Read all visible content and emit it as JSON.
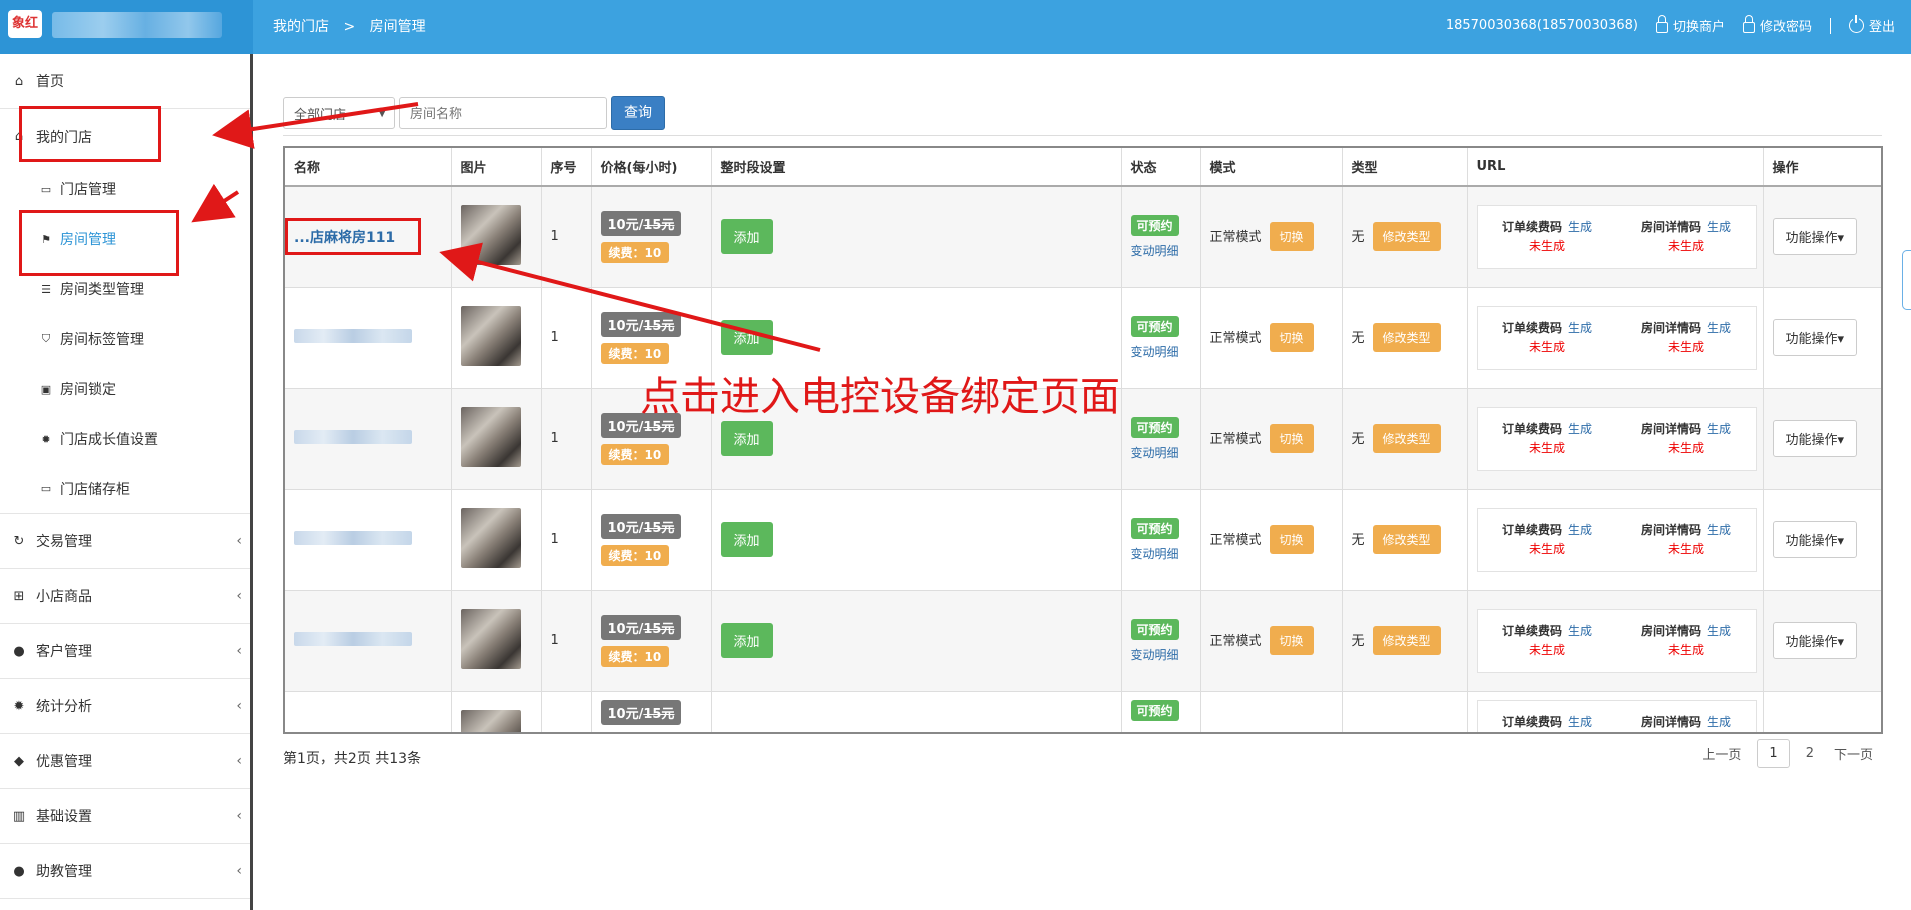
{
  "header": {
    "logo_text": "象红",
    "breadcrumb": [
      "我的门店",
      ">",
      "房间管理"
    ],
    "account": "18570030368(18570030368)",
    "switch_merchant": "切换商户",
    "change_password": "修改密码",
    "logout": "登出"
  },
  "sidebar": {
    "items": [
      {
        "label": "首页",
        "icon": "home-icon"
      },
      {
        "label": "我的门店",
        "icon": "home-icon"
      },
      {
        "label": "交易管理",
        "icon": "refresh-icon"
      },
      {
        "label": "小店商品",
        "icon": "gift-icon"
      },
      {
        "label": "客户管理",
        "icon": "user-icon"
      },
      {
        "label": "统计分析",
        "icon": "gear-icon"
      },
      {
        "label": "优惠管理",
        "icon": "tags-icon"
      },
      {
        "label": "基础设置",
        "icon": "barcode-icon"
      },
      {
        "label": "助教管理",
        "icon": "user-icon"
      }
    ],
    "subitems": [
      {
        "label": "门店管理"
      },
      {
        "label": "房间管理"
      },
      {
        "label": "房间类型管理"
      },
      {
        "label": "房间标签管理"
      },
      {
        "label": "房间锁定"
      },
      {
        "label": "门店成长值设置"
      },
      {
        "label": "门店储存柜"
      }
    ]
  },
  "search": {
    "store_select": "全部门店",
    "room_placeholder": "房间名称",
    "query_button": "查询"
  },
  "table": {
    "headers": [
      "名称",
      "图片",
      "序号",
      "价格(每小时)",
      "整时段设置",
      "状态",
      "模式",
      "类型",
      "URL",
      "操作"
    ],
    "rows": [
      {
        "name": "...店麻将房111",
        "seq": "1",
        "price": "10元/",
        "price_old": "15元",
        "renew": "续费：10",
        "add": "添加",
        "state": "可预约",
        "state_detail": "变动明细",
        "mode": "正常模式",
        "switch": "切换",
        "type": "无",
        "change_type": "修改类型",
        "url_order": "订单续费码",
        "url_room": "房间详情码",
        "gen": "生成",
        "not_gen": "未生成",
        "op": "功能操作▾"
      },
      {
        "name": "",
        "seq": "1",
        "price": "10元/",
        "price_old": "15元",
        "renew": "续费：10",
        "add": "添加",
        "state": "可预约",
        "state_detail": "变动明细",
        "mode": "正常模式",
        "switch": "切换",
        "type": "无",
        "change_type": "修改类型",
        "url_order": "订单续费码",
        "url_room": "房间详情码",
        "gen": "生成",
        "not_gen": "未生成",
        "op": "功能操作▾"
      },
      {
        "name": "",
        "seq": "1",
        "price": "10元/",
        "price_old": "15元",
        "renew": "续费：10",
        "add": "添加",
        "state": "可预约",
        "state_detail": "变动明细",
        "mode": "正常模式",
        "switch": "切换",
        "type": "无",
        "change_type": "修改类型",
        "url_order": "订单续费码",
        "url_room": "房间详情码",
        "gen": "生成",
        "not_gen": "未生成",
        "op": "功能操作▾"
      },
      {
        "name": "",
        "seq": "1",
        "price": "10元/",
        "price_old": "15元",
        "renew": "续费：10",
        "add": "添加",
        "state": "可预约",
        "state_detail": "变动明细",
        "mode": "正常模式",
        "switch": "切换",
        "type": "无",
        "change_type": "修改类型",
        "url_order": "订单续费码",
        "url_room": "房间详情码",
        "gen": "生成",
        "not_gen": "未生成",
        "op": "功能操作▾"
      },
      {
        "name": "",
        "seq": "1",
        "price": "10元/",
        "price_old": "15元",
        "renew": "续费：10",
        "add": "添加",
        "state": "可预约",
        "state_detail": "变动明细",
        "mode": "正常模式",
        "switch": "切换",
        "type": "无",
        "change_type": "修改类型",
        "url_order": "订单续费码",
        "url_room": "房间详情码",
        "gen": "生成",
        "not_gen": "未生成",
        "op": "功能操作▾"
      },
      {
        "name": "",
        "seq": "",
        "price": "10元/",
        "price_old": "15元",
        "renew": "",
        "add": "",
        "state": "可预约",
        "state_detail": "",
        "mode": "",
        "switch": "",
        "type": "",
        "change_type": "",
        "url_order": "订单续费码",
        "url_room": "房间详情码",
        "gen": "生成",
        "not_gen": "",
        "op": ""
      }
    ]
  },
  "pagination": {
    "info": "第1页，共2页 共13条",
    "prev": "上一页",
    "pages": [
      "1",
      "2"
    ],
    "next": "下一页"
  },
  "annotation": {
    "text": "点击进入电控设备绑定页面",
    "color": "#e01818"
  },
  "colors": {
    "topbar": "#3ca2e0",
    "green": "#5cb85c",
    "orange": "#f0ad4e",
    "link": "#2d6ca8"
  }
}
